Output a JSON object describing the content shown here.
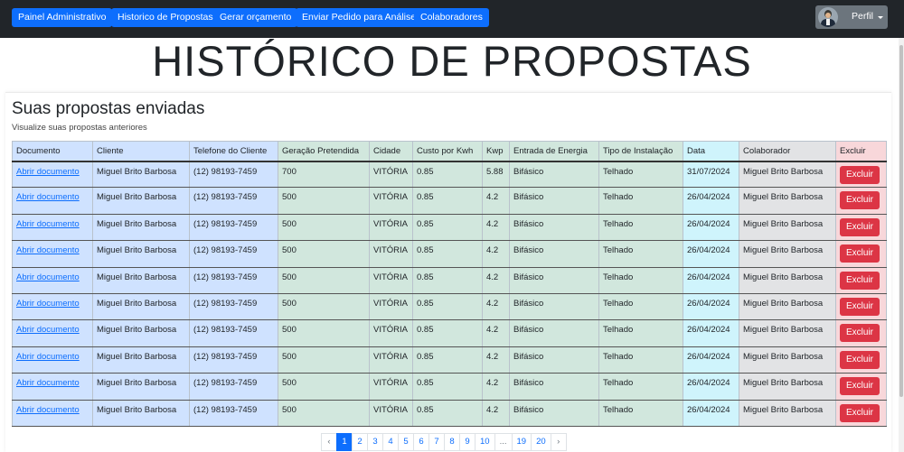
{
  "nav": {
    "buttons": [
      {
        "label": "Painel Administrativo"
      },
      {
        "label": "Historico de Propostas"
      },
      {
        "label": "Gerar orçamento"
      },
      {
        "label": "Enviar Pedido para Análise"
      },
      {
        "label": "Colaboradores"
      }
    ],
    "profile_label": "Perfil"
  },
  "page_title": "HISTÓRICO DE PROPOSTAS",
  "card": {
    "title": "Suas propostas enviadas",
    "subtitle": "Visualize suas propostas anteriores"
  },
  "table": {
    "headers": [
      "Documento",
      "Cliente",
      "Telefone do Cliente",
      "Geração Pretendida",
      "Cidade",
      "Custo por Kwh",
      "Kwp",
      "Entrada de Energia",
      "Tipo de Instalação",
      "Data",
      "Colaborador",
      "Excluir"
    ],
    "rows": [
      {
        "doc": "Abrir documento",
        "cliente": "Miguel Brito Barbosa",
        "telefone": "(12) 98193-7459",
        "geracao": "700",
        "cidade": "VITÓRIA",
        "custo": "0.85",
        "kwp": "5.88",
        "entrada": "Bifásico",
        "tipo": "Telhado",
        "data": "31/07/2024",
        "colaborador": "Miguel Brito Barbosa",
        "excluir": "Excluir"
      },
      {
        "doc": "Abrir documento",
        "cliente": "Miguel Brito Barbosa",
        "telefone": "(12) 98193-7459",
        "geracao": "500",
        "cidade": "VITÓRIA",
        "custo": "0.85",
        "kwp": "4.2",
        "entrada": "Bifásico",
        "tipo": "Telhado",
        "data": "26/04/2024",
        "colaborador": "Miguel Brito Barbosa",
        "excluir": "Excluir"
      },
      {
        "doc": "Abrir documento",
        "cliente": "Miguel Brito Barbosa",
        "telefone": "(12) 98193-7459",
        "geracao": "500",
        "cidade": "VITÓRIA",
        "custo": "0.85",
        "kwp": "4.2",
        "entrada": "Bifásico",
        "tipo": "Telhado",
        "data": "26/04/2024",
        "colaborador": "Miguel Brito Barbosa",
        "excluir": "Excluir"
      },
      {
        "doc": "Abrir documento",
        "cliente": "Miguel Brito Barbosa",
        "telefone": "(12) 98193-7459",
        "geracao": "500",
        "cidade": "VITÓRIA",
        "custo": "0.85",
        "kwp": "4.2",
        "entrada": "Bifásico",
        "tipo": "Telhado",
        "data": "26/04/2024",
        "colaborador": "Miguel Brito Barbosa",
        "excluir": "Excluir"
      },
      {
        "doc": "Abrir documento",
        "cliente": "Miguel Brito Barbosa",
        "telefone": "(12) 98193-7459",
        "geracao": "500",
        "cidade": "VITÓRIA",
        "custo": "0.85",
        "kwp": "4.2",
        "entrada": "Bifásico",
        "tipo": "Telhado",
        "data": "26/04/2024",
        "colaborador": "Miguel Brito Barbosa",
        "excluir": "Excluir"
      },
      {
        "doc": "Abrir documento",
        "cliente": "Miguel Brito Barbosa",
        "telefone": "(12) 98193-7459",
        "geracao": "500",
        "cidade": "VITÓRIA",
        "custo": "0.85",
        "kwp": "4.2",
        "entrada": "Bifásico",
        "tipo": "Telhado",
        "data": "26/04/2024",
        "colaborador": "Miguel Brito Barbosa",
        "excluir": "Excluir"
      },
      {
        "doc": "Abrir documento",
        "cliente": "Miguel Brito Barbosa",
        "telefone": "(12) 98193-7459",
        "geracao": "500",
        "cidade": "VITÓRIA",
        "custo": "0.85",
        "kwp": "4.2",
        "entrada": "Bifásico",
        "tipo": "Telhado",
        "data": "26/04/2024",
        "colaborador": "Miguel Brito Barbosa",
        "excluir": "Excluir"
      },
      {
        "doc": "Abrir documento",
        "cliente": "Miguel Brito Barbosa",
        "telefone": "(12) 98193-7459",
        "geracao": "500",
        "cidade": "VITÓRIA",
        "custo": "0.85",
        "kwp": "4.2",
        "entrada": "Bifásico",
        "tipo": "Telhado",
        "data": "26/04/2024",
        "colaborador": "Miguel Brito Barbosa",
        "excluir": "Excluir"
      },
      {
        "doc": "Abrir documento",
        "cliente": "Miguel Brito Barbosa",
        "telefone": "(12) 98193-7459",
        "geracao": "500",
        "cidade": "VITÓRIA",
        "custo": "0.85",
        "kwp": "4.2",
        "entrada": "Bifásico",
        "tipo": "Telhado",
        "data": "26/04/2024",
        "colaborador": "Miguel Brito Barbosa",
        "excluir": "Excluir"
      },
      {
        "doc": "Abrir documento",
        "cliente": "Miguel Brito Barbosa",
        "telefone": "(12) 98193-7459",
        "geracao": "500",
        "cidade": "VITÓRIA",
        "custo": "0.85",
        "kwp": "4.2",
        "entrada": "Bifásico",
        "tipo": "Telhado",
        "data": "26/04/2024",
        "colaborador": "Miguel Brito Barbosa",
        "excluir": "Excluir"
      }
    ]
  },
  "pagination": {
    "prev": "‹",
    "pages": [
      "1",
      "2",
      "3",
      "4",
      "5",
      "6",
      "7",
      "8",
      "9",
      "10",
      "...",
      "19",
      "20"
    ],
    "current": "1",
    "next": "›"
  },
  "colors": {
    "navbar": "#212529",
    "primary": "#0d6efd",
    "danger": "#dc3545",
    "col_blue": "#cfe2ff",
    "col_green": "#d1e7dd",
    "col_cyan": "#cff4fc",
    "col_gray": "#e2e3e5",
    "col_red": "#f8d7da"
  },
  "icons": {
    "profile": "user-avatar-icon",
    "dropdown": "caret-down-icon"
  }
}
